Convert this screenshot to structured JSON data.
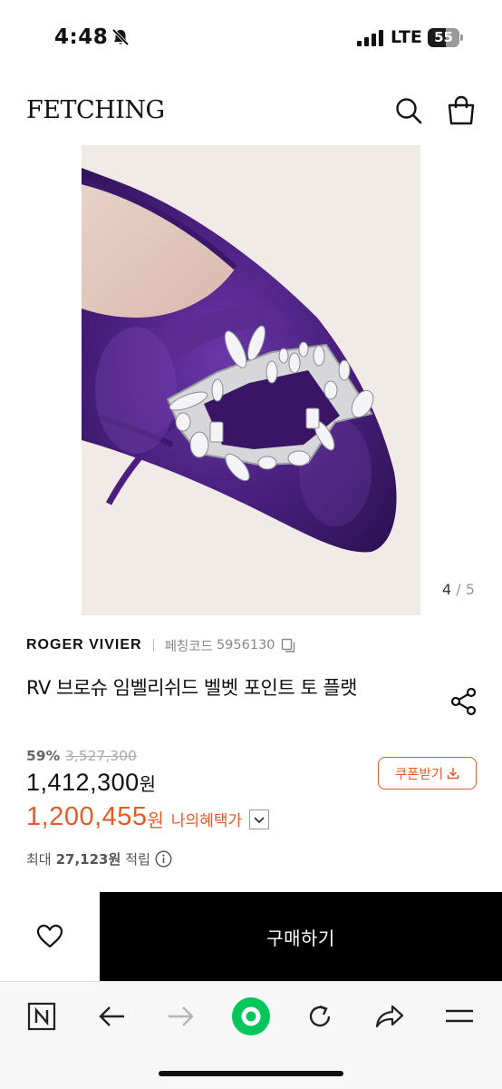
{
  "status_bar": {
    "time": "4:48",
    "network": "LTE",
    "battery_level": "55",
    "battery_fraction": 0.55
  },
  "header": {
    "logo": "FETCHING",
    "icons": [
      "search-icon",
      "shopping-bag-icon"
    ]
  },
  "gallery": {
    "current": "4",
    "separator": "/",
    "total": "5",
    "image_description_icon": "purple-velvet-flat-with-crystal-buckle"
  },
  "product": {
    "brand": "ROGER VIVIER",
    "code_label": "페칭코드",
    "code": "5956130",
    "title": "RV 브로슈 임벨리쉬드 벨벳 포인트 토 플랫"
  },
  "pricing": {
    "discount_rate": "59%",
    "original_price": "3,527,300",
    "sale_price": "1,412,300",
    "sale_currency": "원",
    "benefit_price": "1,200,455",
    "benefit_currency": "원",
    "benefit_label": "나의혜택가",
    "coupon_label": "쿠폰받기",
    "points_prefix": "최대",
    "points_amount": "27,123원",
    "points_suffix": "적립"
  },
  "actions": {
    "buy_label": "구매하기"
  },
  "browser_toolbar": {
    "items": [
      "naver-n-icon",
      "back-arrow-icon",
      "forward-arrow-icon",
      "green-home-icon",
      "refresh-icon",
      "share-arrow-icon",
      "menu-icon"
    ]
  },
  "colors": {
    "accent": "#e35b29",
    "buy_bg": "#000000",
    "green": "#03c75a",
    "velvet": "#4a2079"
  }
}
